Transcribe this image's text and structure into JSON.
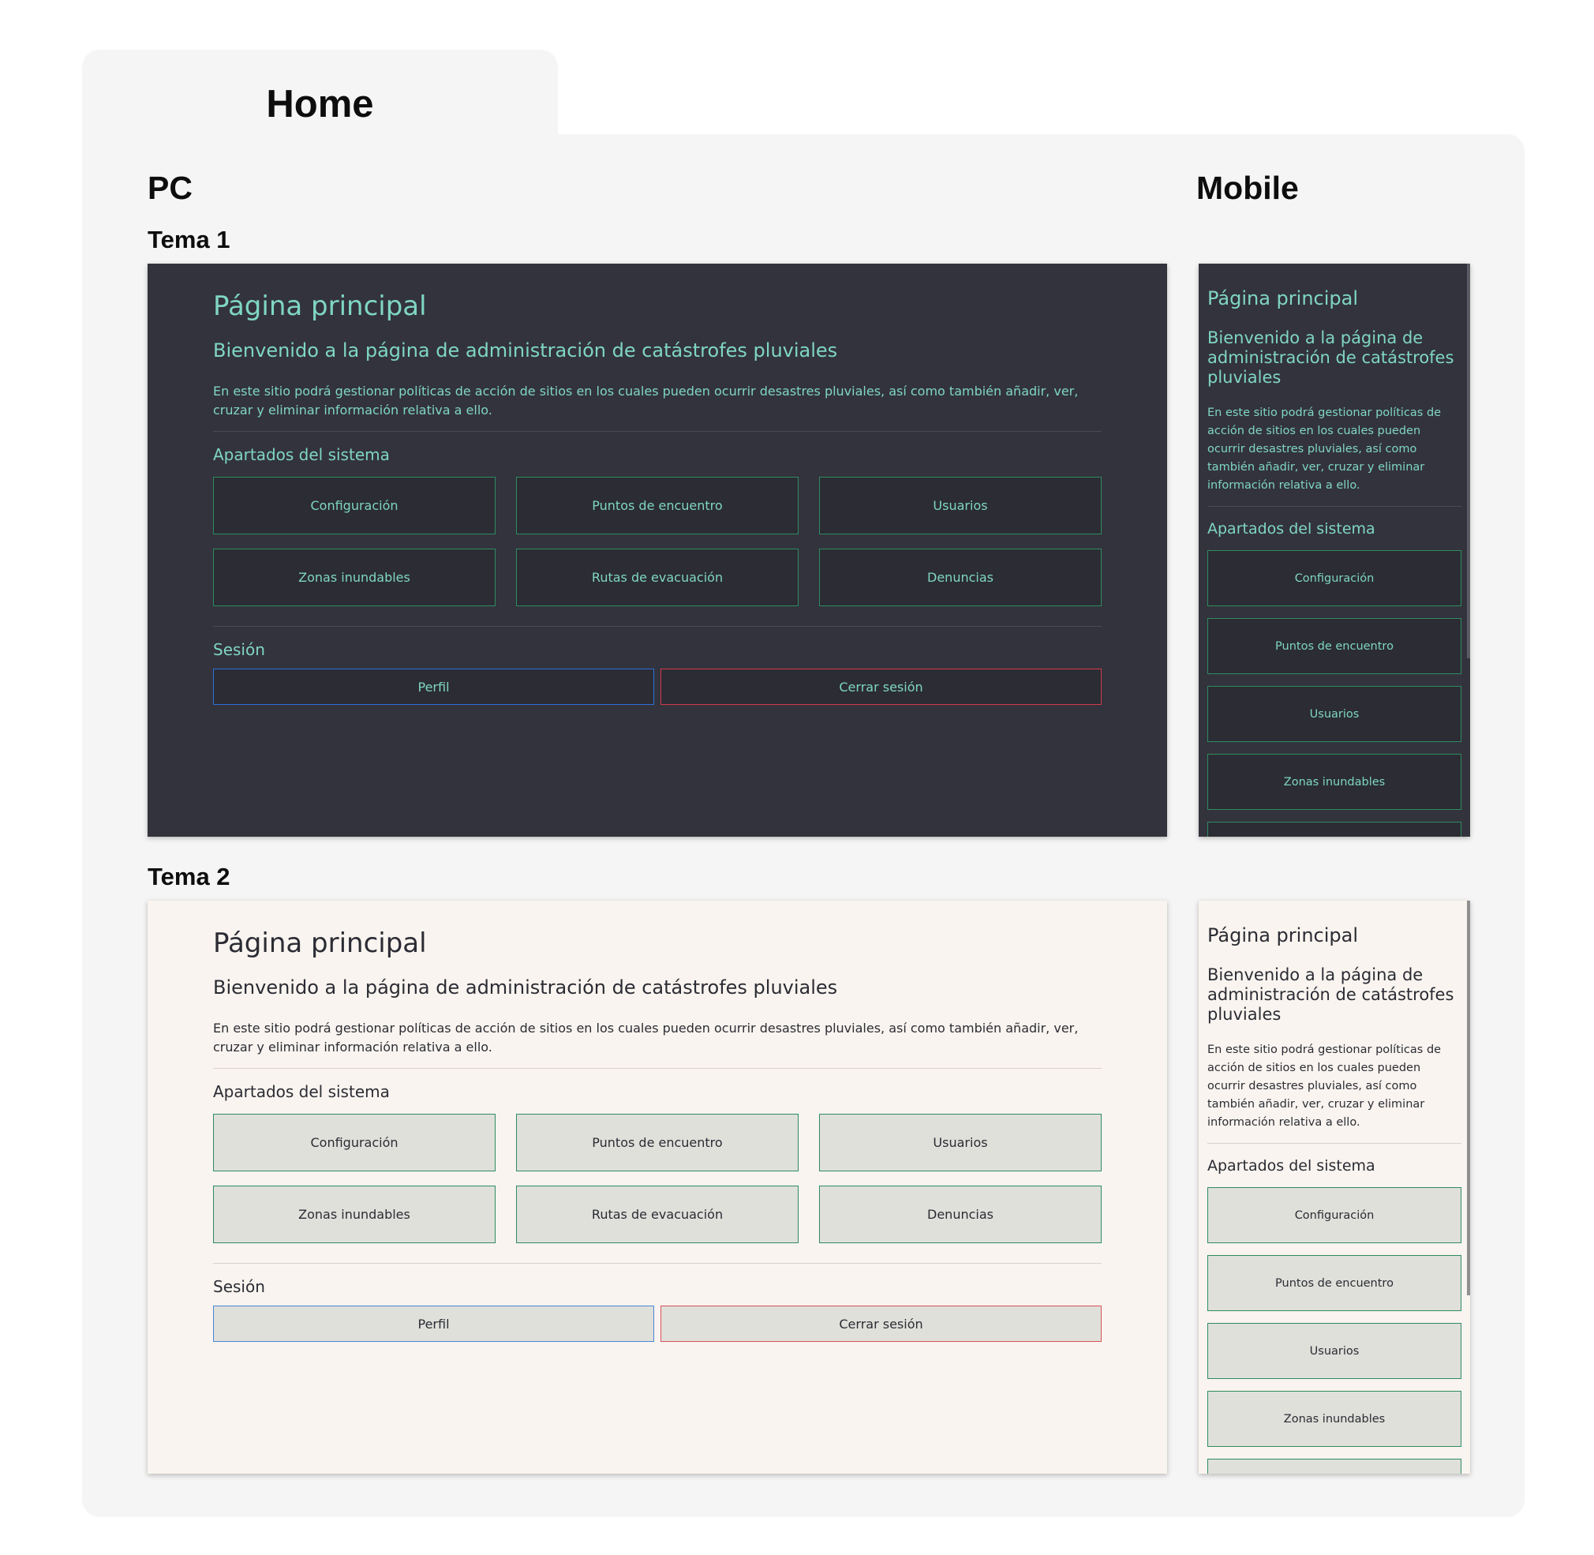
{
  "board": {
    "tab_title": "Home",
    "pc_heading": "PC",
    "mobile_heading": "Mobile",
    "theme1_label": "Tema 1",
    "theme2_label": "Tema 2"
  },
  "themes": {
    "theme1": {
      "background": "#33333d",
      "text": "#7fd6c2",
      "button_bg": "#2b2c34",
      "accent_border": "#2f8c5f",
      "profile_border": "#2f6fd9",
      "logout_border": "#d43a48"
    },
    "theme2": {
      "background": "#f9f4ef",
      "text": "#2b2c34",
      "button_bg": "#dfe0da",
      "accent_border": "#2f8c5f",
      "profile_border": "#4a86d8",
      "logout_border": "#d9505b"
    }
  },
  "page": {
    "title": "Página principal",
    "subtitle": "Bienvenido a la página de administración de catástrofes pluviales",
    "description": "En este sitio podrá gestionar políticas de acción de sitios en los cuales pueden ocurrir desastres pluviales, así como también añadir, ver, cruzar y eliminar información relativa a ello.",
    "sections_title": "Apartados del sistema",
    "sections": [
      "Configuración",
      "Puntos de encuentro",
      "Usuarios",
      "Zonas inundables",
      "Rutas de evacuación",
      "Denuncias"
    ],
    "session_title": "Sesión",
    "profile_label": "Perfil",
    "logout_label": "Cerrar sesión"
  }
}
